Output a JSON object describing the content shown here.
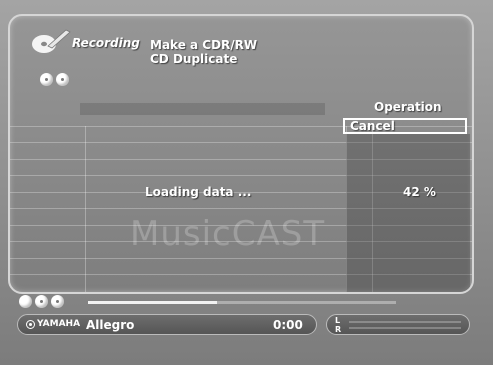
{
  "header": {
    "mode_label": "Recording",
    "title_line1": "Make a CDR/RW",
    "title_line2": "CD Duplicate"
  },
  "operation": {
    "header": "Operation",
    "cancel_label": "Cancel"
  },
  "status": {
    "loading_text": "Loading data ...",
    "percent_text": "42 %",
    "progress_fraction": 0.42
  },
  "player": {
    "brand": "YAMAHA",
    "track_name": "Allegro",
    "time": "0:00",
    "level_left": "L",
    "level_right": "R"
  },
  "watermark": "MusicCAST",
  "icons": {
    "logo": "recording-disc-icon",
    "nav": "cd-dots-icon"
  }
}
